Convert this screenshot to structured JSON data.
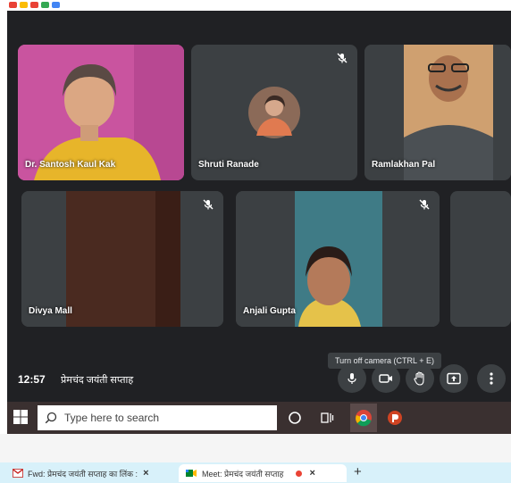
{
  "participants": [
    {
      "name": "Dr. Santosh Kaul Kak",
      "muted": false
    },
    {
      "name": "Shruti Ranade",
      "muted": true
    },
    {
      "name": "Ramlakhan Pal",
      "muted": false
    },
    {
      "name": "Divya Mall",
      "muted": true
    },
    {
      "name": "Anjali Gupta",
      "muted": true
    }
  ],
  "meeting": {
    "time": "12:57",
    "title": "प्रेमचंद जयंती सप्ताह"
  },
  "tooltip": "Turn off camera (CTRL + E)",
  "controls": [
    "mic-icon",
    "camera-icon",
    "raise-hand-icon",
    "present-icon",
    "more-icon"
  ],
  "taskbar": {
    "search_placeholder": "Type here to search"
  },
  "browser_tabs": [
    {
      "label": "Fwd: प्रेमचंद जयंती सप्ताह का लिंक :",
      "icon": "gmail-icon",
      "close": "×"
    },
    {
      "label": "Meet: प्रेमचंद जयंती सप्ताह",
      "icon": "meet-icon",
      "close": "×"
    }
  ],
  "new_tab": "+",
  "colors": {
    "meet_bg": "#202124",
    "tile_bg": "#3c4043",
    "taskbar_bg": "#3a3030",
    "tabbar_bg": "#d8f1fa",
    "recording": "#ea4335"
  }
}
